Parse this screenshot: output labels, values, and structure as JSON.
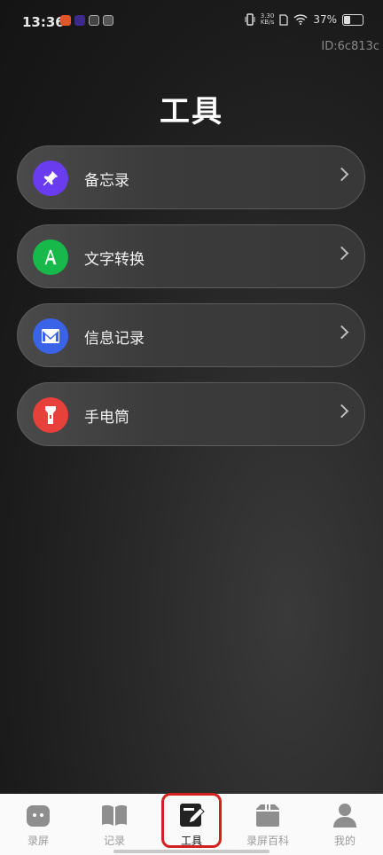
{
  "status_bar": {
    "time": "13:36",
    "speed_top": "3.30",
    "speed_bottom": "KB/s",
    "battery": "37%"
  },
  "device_id": "ID:6c813c",
  "page_title": "工具",
  "tools": [
    {
      "label": "备忘录",
      "icon": "pin-icon",
      "color": "#6a3cf0"
    },
    {
      "label": "文字转换",
      "icon": "letter-a-icon",
      "color": "#17b94a"
    },
    {
      "label": "信息记录",
      "icon": "mail-icon",
      "color": "#3a63e8"
    },
    {
      "label": "手电筒",
      "icon": "flashlight-icon",
      "color": "#e8403a"
    }
  ],
  "tabbar": {
    "tabs": [
      {
        "label": "录屏",
        "icon": "screen-record-icon"
      },
      {
        "label": "记录",
        "icon": "book-icon"
      },
      {
        "label": "工具",
        "icon": "edit-tool-icon",
        "active": true
      },
      {
        "label": "录屏百科",
        "icon": "box-icon"
      },
      {
        "label": "我的",
        "icon": "user-icon"
      }
    ]
  }
}
